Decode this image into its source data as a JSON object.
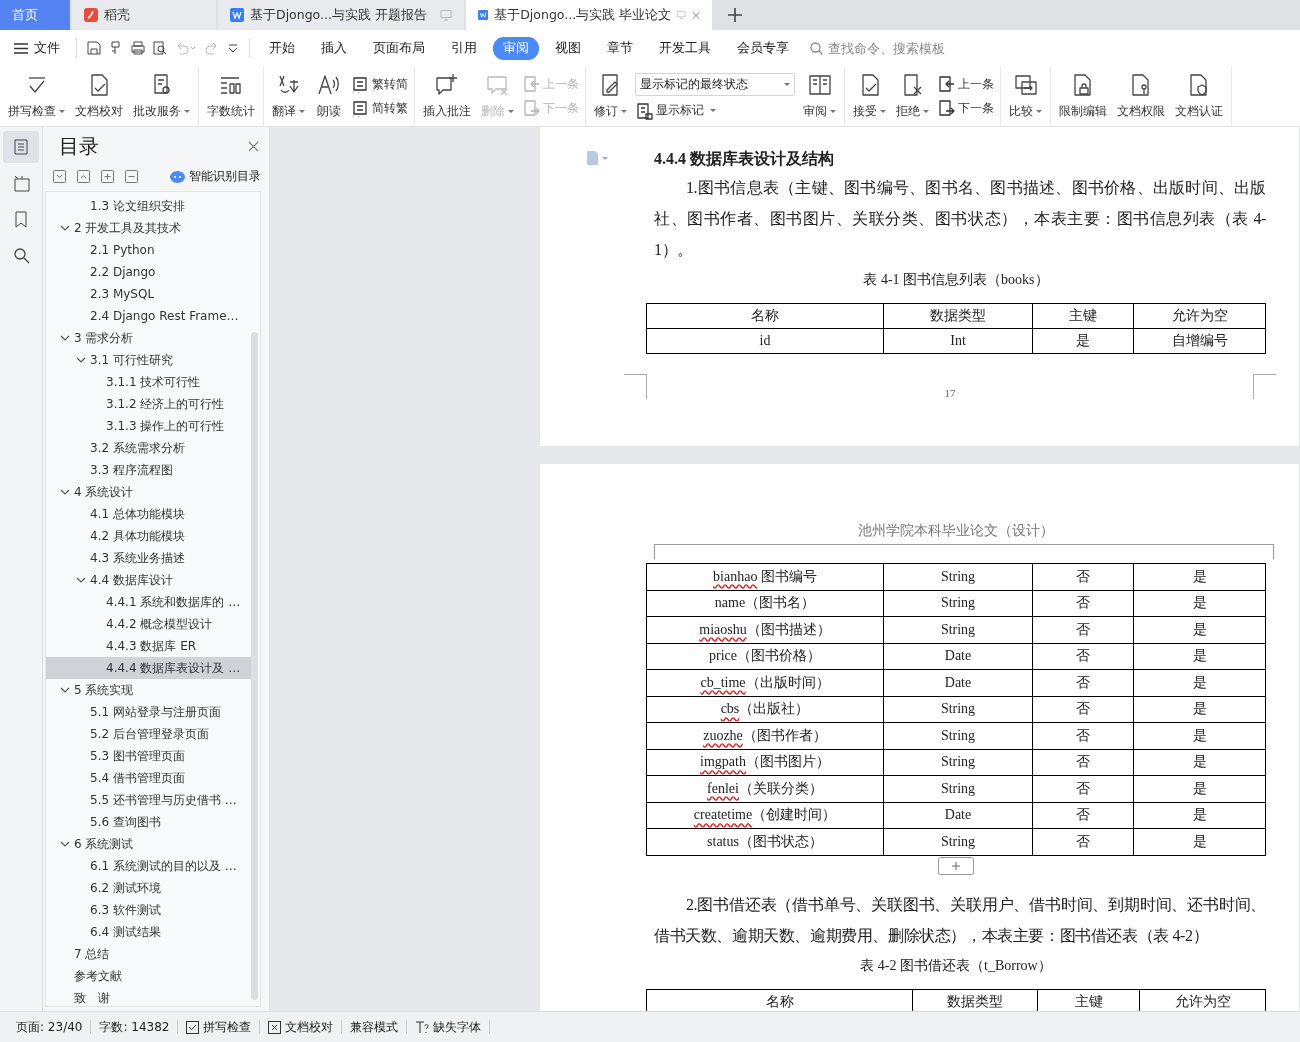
{
  "tabs": [
    {
      "kind": "home",
      "label": "首页",
      "selected": false
    },
    {
      "kind": "app",
      "label": "稻壳",
      "selected": false
    },
    {
      "kind": "doc",
      "label": "基于Djongo...与实践 开题报告",
      "selected": false
    },
    {
      "kind": "doc",
      "label": "基于Djongo...与实践 毕业论文",
      "selected": true
    }
  ],
  "menu": {
    "file": "文件",
    "tabs": [
      {
        "label": "开始",
        "selected": false
      },
      {
        "label": "插入",
        "selected": false
      },
      {
        "label": "页面布局",
        "selected": false
      },
      {
        "label": "引用",
        "selected": false
      },
      {
        "label": "审阅",
        "selected": true
      },
      {
        "label": "视图",
        "selected": false
      },
      {
        "label": "章节",
        "selected": false
      },
      {
        "label": "开发工具",
        "selected": false
      },
      {
        "label": "会员专享",
        "selected": false
      }
    ],
    "search": {
      "placeholder": "查找命令、搜索模板"
    }
  },
  "ribbon": [
    [
      {
        "kind": "big",
        "label": "拼写检查",
        "dropdown": true,
        "disabled": false
      },
      {
        "kind": "big",
        "label": "文档校对",
        "dropdown": false,
        "disabled": false
      },
      {
        "kind": "big",
        "label": "批改服务",
        "dropdown": true,
        "disabled": false
      }
    ],
    [
      {
        "kind": "big",
        "label": "字数统计",
        "dropdown": false,
        "disabled": false
      }
    ],
    [
      {
        "kind": "big",
        "label": "翻译",
        "dropdown": true,
        "disabled": false
      },
      {
        "kind": "big",
        "label": "朗读",
        "dropdown": false,
        "disabled": false
      },
      {
        "kind": "pair",
        "items": [
          {
            "label": "繁转简",
            "disabled": false
          },
          {
            "label": "简转繁",
            "disabled": false
          }
        ]
      }
    ],
    [
      {
        "kind": "big",
        "label": "插入批注",
        "dropdown": false,
        "disabled": false
      },
      {
        "kind": "big",
        "label": "删除",
        "dropdown": true,
        "disabled": true
      },
      {
        "kind": "pair",
        "items": [
          {
            "label": "上一条",
            "disabled": true
          },
          {
            "label": "下一条",
            "disabled": true
          }
        ]
      }
    ],
    [
      {
        "kind": "big",
        "label": "修订",
        "dropdown": true,
        "disabled": false
      },
      {
        "kind": "select",
        "value": "显示标记的最终状态",
        "sub": "显示标记"
      },
      {
        "kind": "big",
        "label": "审阅",
        "dropdown": true,
        "disabled": false
      }
    ],
    [
      {
        "kind": "big",
        "label": "接受",
        "dropdown": true,
        "disabled": false
      },
      {
        "kind": "big",
        "label": "拒绝",
        "dropdown": true,
        "disabled": false
      },
      {
        "kind": "pair",
        "items": [
          {
            "label": "上一条",
            "disabled": false
          },
          {
            "label": "下一条",
            "disabled": false
          }
        ]
      }
    ],
    [
      {
        "kind": "big",
        "label": "比较",
        "dropdown": true,
        "disabled": false
      }
    ],
    [
      {
        "kind": "big",
        "label": "限制编辑",
        "dropdown": false,
        "disabled": false
      },
      {
        "kind": "big",
        "label": "文档权限",
        "dropdown": false,
        "disabled": false
      },
      {
        "kind": "big",
        "label": "文档认证",
        "dropdown": false,
        "disabled": false
      }
    ]
  ],
  "toc": {
    "title": "目录",
    "smart": "智能识别目录",
    "continued": [
      {
        "label": "1.3  论文组织安排",
        "selected": false
      }
    ],
    "items": [
      {
        "label": "2  开发工具及其技术",
        "selected": false,
        "expanded": true,
        "children": [
          {
            "label": "2.1 Python",
            "selected": false
          },
          {
            "label": "2.2 Django",
            "selected": false
          },
          {
            "label": "2.3 MySQL",
            "selected": false
          },
          {
            "label": "2.4 Django Rest Frame…",
            "selected": false
          }
        ]
      },
      {
        "label": "3  需求分析",
        "selected": false,
        "expanded": true,
        "children": [
          {
            "label": "3.1  可行性研究",
            "selected": false,
            "expanded": true,
            "children": [
              {
                "label": "3.1.1  技术可行性",
                "selected": false
              },
              {
                "label": "3.1.2  经济上的可行性",
                "selected": false
              },
              {
                "label": "3.1.3  操作上的可行性",
                "selected": false
              }
            ]
          },
          {
            "label": "3.2  系统需求分析",
            "selected": false
          },
          {
            "label": "3.3  程序流程图",
            "selected": false
          }
        ]
      },
      {
        "label": "4  系统设计",
        "selected": false,
        "expanded": true,
        "children": [
          {
            "label": "4.1  总体功能模块",
            "selected": false
          },
          {
            "label": "4.2  具体功能模块",
            "selected": false
          },
          {
            "label": "4.3  系统业务描述",
            "selected": false
          },
          {
            "label": "4.4  数据库设计",
            "selected": false,
            "expanded": true,
            "children": [
              {
                "label": "4.4.1 系统和数据库的 …",
                "selected": false
              },
              {
                "label": "4.4.2  概念模型设计",
                "selected": false
              },
              {
                "label": "4.4.3  数据库 ER",
                "selected": false
              },
              {
                "label": "4.4.4  数据库表设计及 …",
                "selected": true
              }
            ]
          }
        ]
      },
      {
        "label": "5  系统实现",
        "selected": false,
        "expanded": true,
        "children": [
          {
            "label": "5.1  网站登录与注册页面",
            "selected": false
          },
          {
            "label": "5.2  后台管理登录页面",
            "selected": false
          },
          {
            "label": "5.3  图书管理页面",
            "selected": false
          },
          {
            "label": "5.4  借书管理页面",
            "selected": false
          },
          {
            "label": "5.5  还书管理与历史借书 …",
            "selected": false
          },
          {
            "label": "5.6  查询图书",
            "selected": false
          }
        ]
      },
      {
        "label": "6  系统测试",
        "selected": false,
        "expanded": true,
        "children": [
          {
            "label": "6.1  系统测试的目的以及 …",
            "selected": false
          },
          {
            "label": "6.2  测试环境",
            "selected": false
          },
          {
            "label": "6.3  软件测试",
            "selected": false
          },
          {
            "label": "6.4  测试结果",
            "selected": false
          }
        ]
      },
      {
        "label": "7  总结",
        "selected": false
      },
      {
        "label": "参考文献",
        "selected": false
      },
      {
        "label": "致　谢",
        "selected": false
      }
    ]
  },
  "page1": {
    "heading": "4.4.4  数据库表设计及结构",
    "paragraph": "1.图书信息表（主键、图书编号、图书名、图书描述、图书价格、出版时间、出版社、图书作者、图书图片、关联分类、图书状态），本表主要：图书信息列表（表 4-1）。",
    "caption": "表 4-1 图书信息列表（books）",
    "columns": [
      "名称",
      "数据类型",
      "主键",
      "允许为空"
    ],
    "rows": [
      {
        "word": "id",
        "rest": "",
        "misspelled": false,
        "type": "Int",
        "key": "是",
        "nullable": "自增编号"
      }
    ],
    "page_number": "17"
  },
  "page2": {
    "header": "池州学院本科毕业论文（设计）",
    "rows": [
      {
        "word": "bianhao",
        "rest": " 图书编号",
        "misspelled": true,
        "type": "String",
        "key": "否",
        "nullable": "是"
      },
      {
        "word": "name",
        "rest": "（图书名）",
        "misspelled": false,
        "type": "String",
        "key": "否",
        "nullable": "是"
      },
      {
        "word": "miaoshu",
        "rest": "（图书描述）",
        "misspelled": true,
        "type": "String",
        "key": "否",
        "nullable": "是"
      },
      {
        "word": "price",
        "rest": "（图书价格）",
        "misspelled": false,
        "type": "Date",
        "key": "否",
        "nullable": "是"
      },
      {
        "word": "cb_time",
        "rest": "（出版时间）",
        "misspelled": true,
        "type": "Date",
        "key": "否",
        "nullable": "是"
      },
      {
        "word": "cbs",
        "rest": "（出版社）",
        "misspelled": true,
        "type": "String",
        "key": "否",
        "nullable": "是"
      },
      {
        "word": "zuozhe",
        "rest": "（图书作者）",
        "misspelled": true,
        "type": "String",
        "key": "否",
        "nullable": "是"
      },
      {
        "word": "imgpath",
        "rest": "（图书图片）",
        "misspelled": true,
        "type": "String",
        "key": "否",
        "nullable": "是"
      },
      {
        "word": "fenlei",
        "rest": "（关联分类）",
        "misspelled": true,
        "type": "String",
        "key": "否",
        "nullable": "是"
      },
      {
        "word": "createtime",
        "rest": "（创建时间）",
        "misspelled": true,
        "type": "Date",
        "key": "否",
        "nullable": "是"
      },
      {
        "word": "status",
        "rest": "（图书状态）",
        "misspelled": false,
        "type": "String",
        "key": "否",
        "nullable": "是"
      }
    ],
    "paragraph": "2.图书借还表（借书单号、关联图书、关联用户、借书时间、到期时间、还书时间、借书天数、逾期天数、逾期费用、删除状态），本表主要：图书借还表（表 4-2）",
    "caption": "表 4-2 图书借还表（t_Borrow）",
    "columns": [
      "名称",
      "数据类型",
      "主键",
      "允许为空"
    ]
  },
  "status_bar": [
    {
      "kind": "text",
      "label": "页面: 23/40"
    },
    {
      "kind": "text",
      "label": "字数: 14382"
    },
    {
      "kind": "check",
      "label": "拼写检查"
    },
    {
      "kind": "cross",
      "label": "文档校对"
    },
    {
      "kind": "text",
      "label": "兼容模式"
    },
    {
      "kind": "font",
      "label": "缺失字体"
    }
  ]
}
